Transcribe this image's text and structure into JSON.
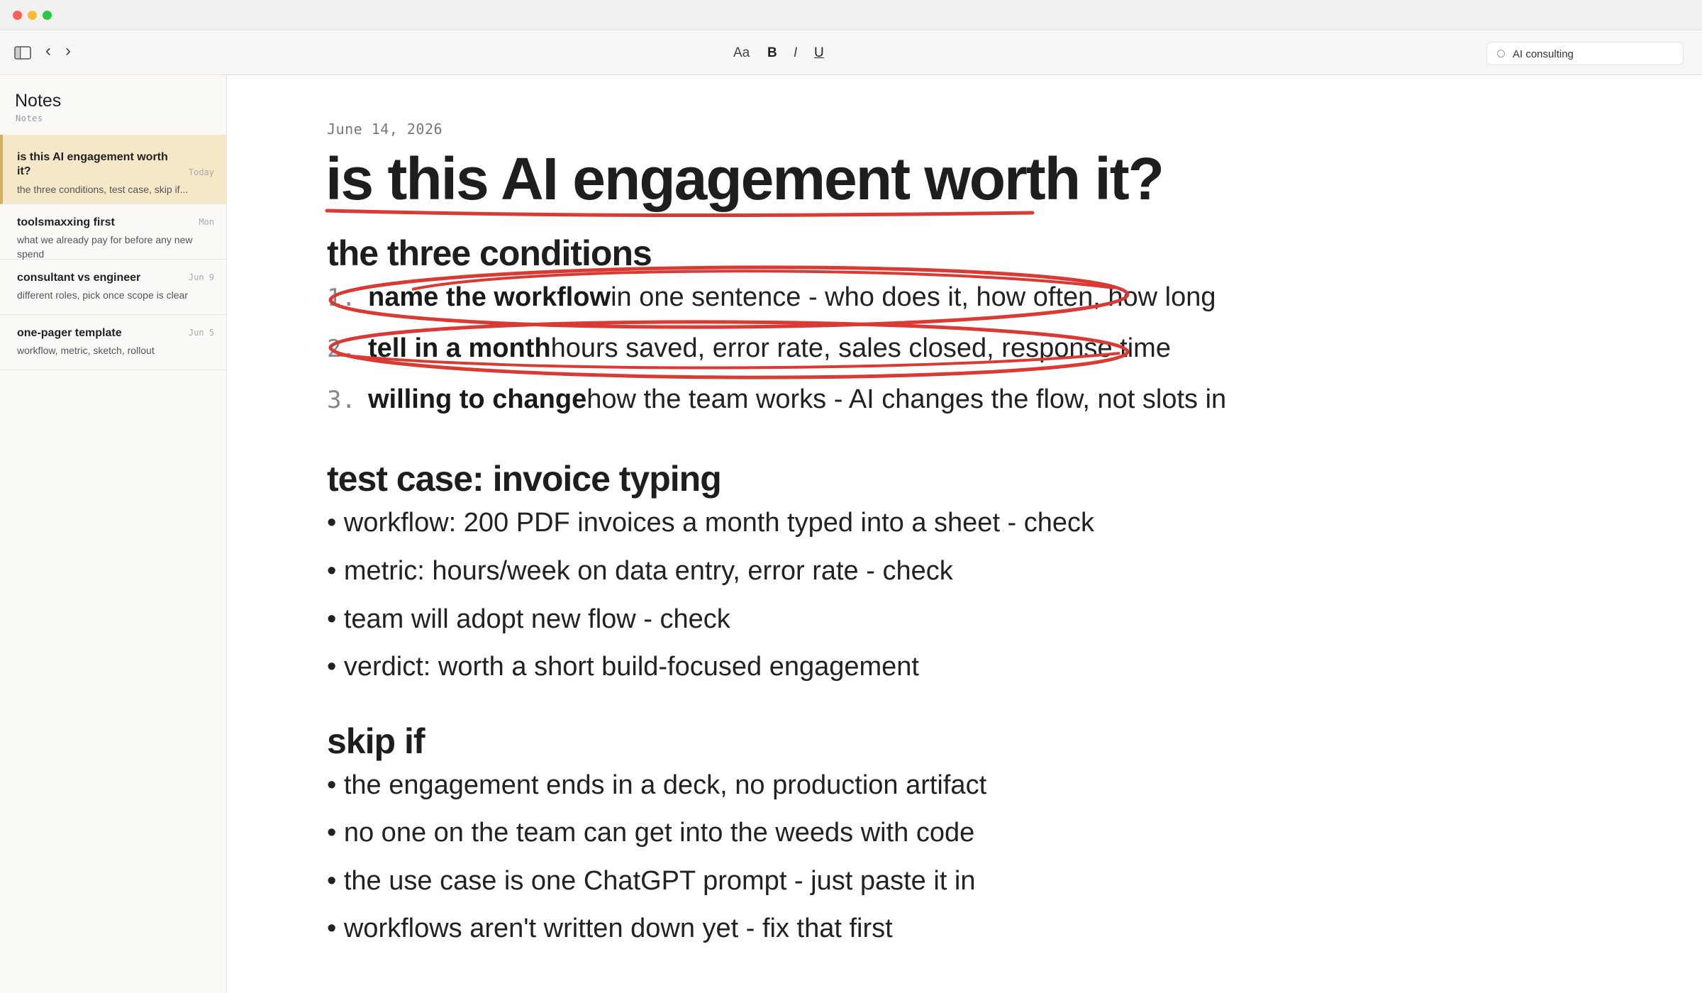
{
  "toolbar": {
    "format_aa": "Aa",
    "format_bold": "B",
    "format_italic": "I",
    "format_underline": "U",
    "search_value": "AI consulting",
    "back": "‹",
    "forward": "›"
  },
  "sidebar": {
    "title": "Notes",
    "subtitle": "Notes",
    "notes": [
      {
        "title": "is this AI engagement worth it?",
        "date": "Today",
        "snippet": "the three conditions, test case, skip if..."
      },
      {
        "title": "toolsmaxxing first",
        "date": "Mon",
        "snippet": "what we already pay for before any new spend"
      },
      {
        "title": "consultant vs engineer",
        "date": "Jun 9",
        "snippet": "different roles, pick once scope is clear"
      },
      {
        "title": "one-pager template",
        "date": "Jun 5",
        "snippet": "workflow, metric, sketch, rollout"
      }
    ]
  },
  "note": {
    "date": "June 14, 2026",
    "title": "is this AI engagement worth it?",
    "sections": [
      {
        "heading": "the three conditions",
        "items": [
          {
            "num": "1.",
            "bold": "name the workflow",
            "text": "in one sentence - who does it, how often, how long"
          },
          {
            "num": "2.",
            "bold": "tell in a month",
            "text": "hours saved, error rate, sales closed, response time"
          },
          {
            "num": "3.",
            "bold": "willing to change",
            "text": "how the team works - AI changes the flow, not slots in"
          }
        ]
      },
      {
        "heading": "test case: invoice typing",
        "items": [
          "• workflow: 200 PDF invoices a month typed into a sheet - check",
          "• metric: hours/week on data entry, error rate - check",
          "• team will adopt new flow - check",
          "• verdict: worth a short build-focused engagement"
        ]
      },
      {
        "heading": "skip if",
        "items": [
          "• the engagement ends in a deck, no production artifact",
          "• no one on the team can get into the weeds with code",
          "• the use case is one ChatGPT prompt - just paste it in",
          "• workflows aren't written down yet - fix that first"
        ]
      }
    ]
  },
  "colors": {
    "annotation_red": "#d93a33",
    "active_note_bg": "#f4e8c8",
    "active_note_accent": "#d6b15d"
  }
}
